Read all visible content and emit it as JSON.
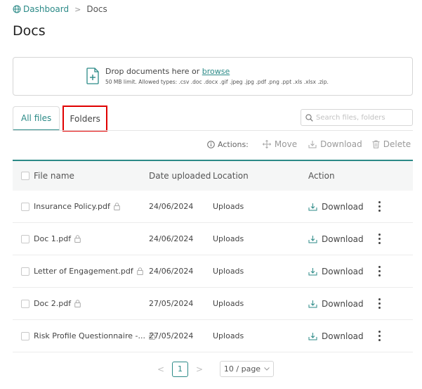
{
  "breadcrumb": {
    "home_label": "Dashboard",
    "separator": ">",
    "current": "Docs"
  },
  "page": {
    "title": "Docs"
  },
  "upload": {
    "prompt": "Drop documents here or ",
    "browse_label": "browse",
    "limit_text": "50 MB limit. Allowed types: .csv .doc .docx .gif .jpeg .jpg .pdf .png .ppt .xls .xlsx .zip."
  },
  "tabs": [
    {
      "label": "All files",
      "active": true
    },
    {
      "label": "Folders",
      "active": false
    }
  ],
  "search": {
    "placeholder": "Search files, folders",
    "value": ""
  },
  "actions": {
    "label": "Actions:",
    "move": "Move",
    "download": "Download",
    "delete": "Delete"
  },
  "table": {
    "columns": {
      "name": "File name",
      "date": "Date uploaded",
      "location": "Location",
      "action": "Action"
    },
    "rows": [
      {
        "name": "Insurance Policy.pdf",
        "date": "24/06/2024",
        "location": "Uploads",
        "action": "Download"
      },
      {
        "name": "Doc 1.pdf",
        "date": "24/06/2024",
        "location": "Uploads",
        "action": "Download"
      },
      {
        "name": "Letter of Engagement.pdf",
        "date": "24/06/2024",
        "location": "Uploads",
        "action": "Download"
      },
      {
        "name": "Doc 2.pdf",
        "date": "27/05/2024",
        "location": "Uploads",
        "action": "Download"
      },
      {
        "name": "Risk Profile Questionnaire -...",
        "date": "27/05/2024",
        "location": "Uploads",
        "action": "Download"
      }
    ]
  },
  "pagination": {
    "prev": "<",
    "current": "1",
    "next": ">",
    "page_size": "10 / page"
  },
  "colors": {
    "accent": "#2b8a87",
    "highlight": "#e00000"
  }
}
